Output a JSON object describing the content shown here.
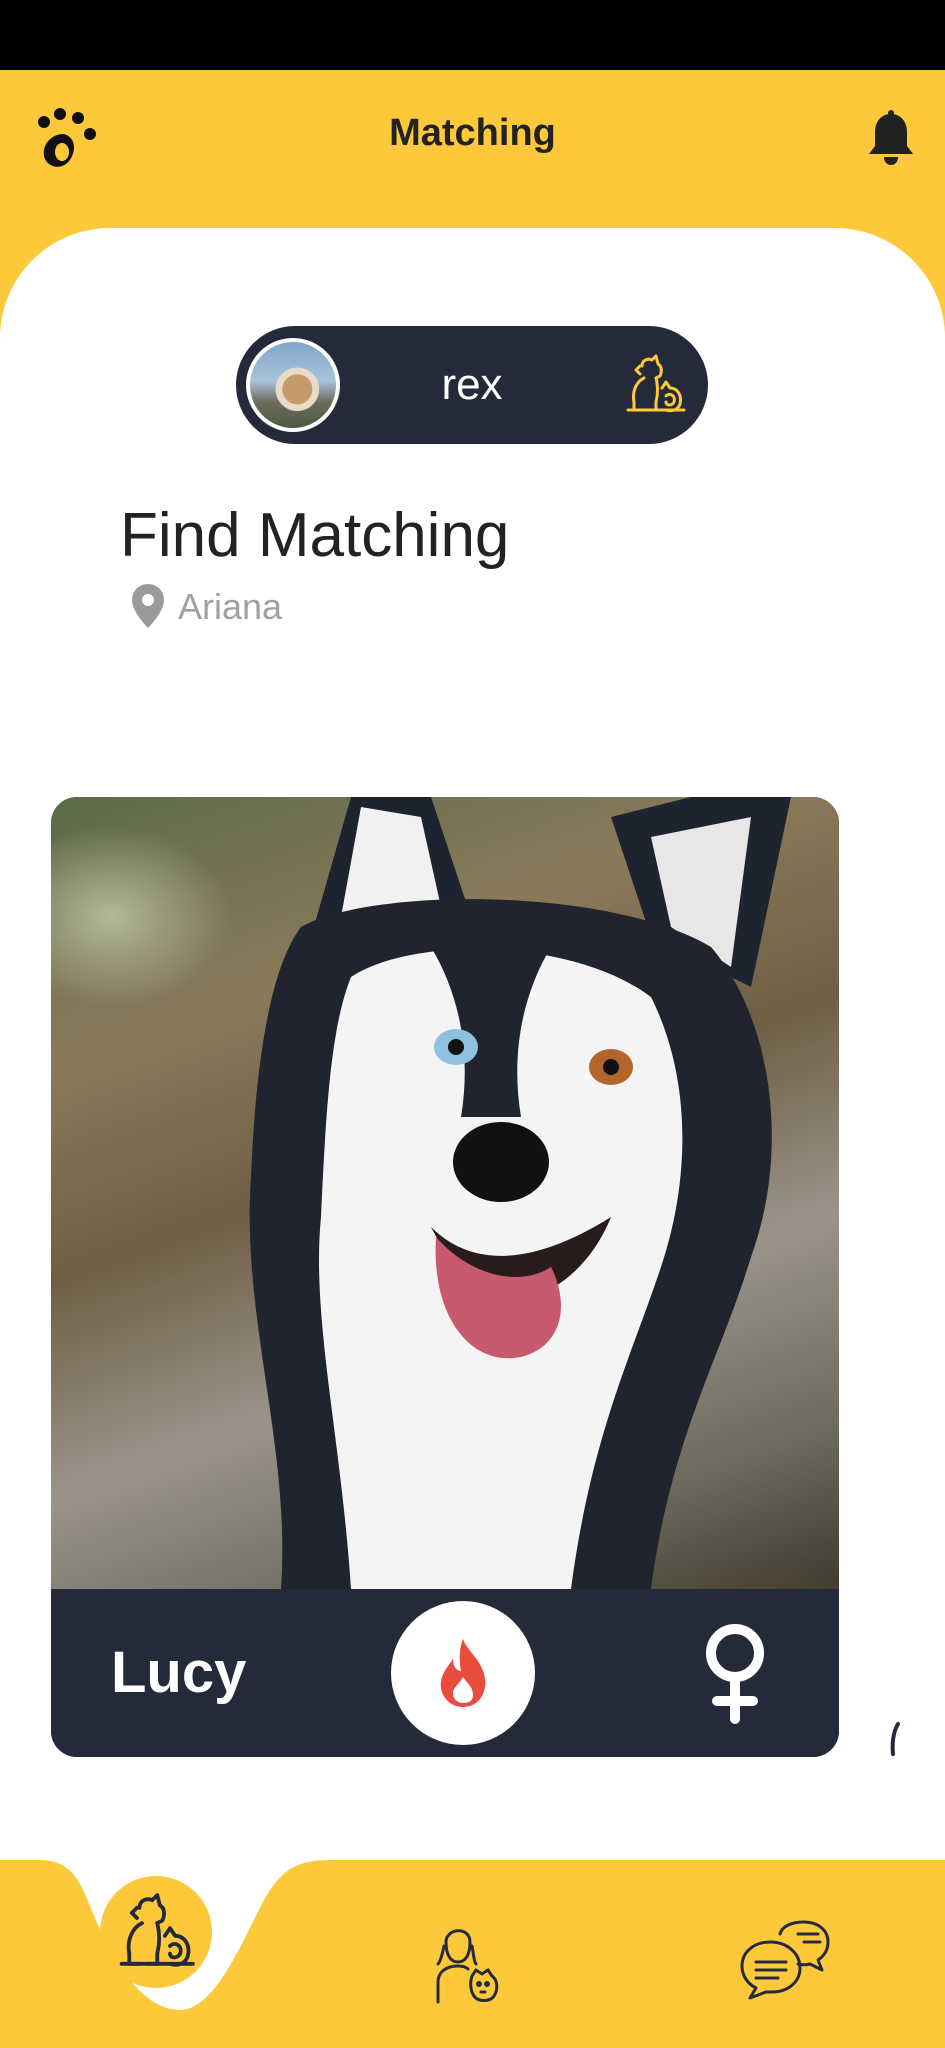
{
  "app_bar": {
    "title": "Matching"
  },
  "pet_selector": {
    "name": "rex"
  },
  "main": {
    "heading": "Find Matching",
    "location": "Ariana"
  },
  "match_card": {
    "name": "Lucy",
    "gender_icon": "female-icon",
    "like_icon": "flame-icon",
    "footer_color": "#252a3a"
  },
  "bottom_nav": {
    "items": [
      {
        "icon": "pets-icon",
        "active": true
      },
      {
        "icon": "owner-with-dog-icon",
        "active": false
      },
      {
        "icon": "chat-icon",
        "active": false
      }
    ]
  },
  "colors": {
    "accent": "#fdc93b",
    "dark": "#252a3a",
    "like": "#e94b3c"
  }
}
